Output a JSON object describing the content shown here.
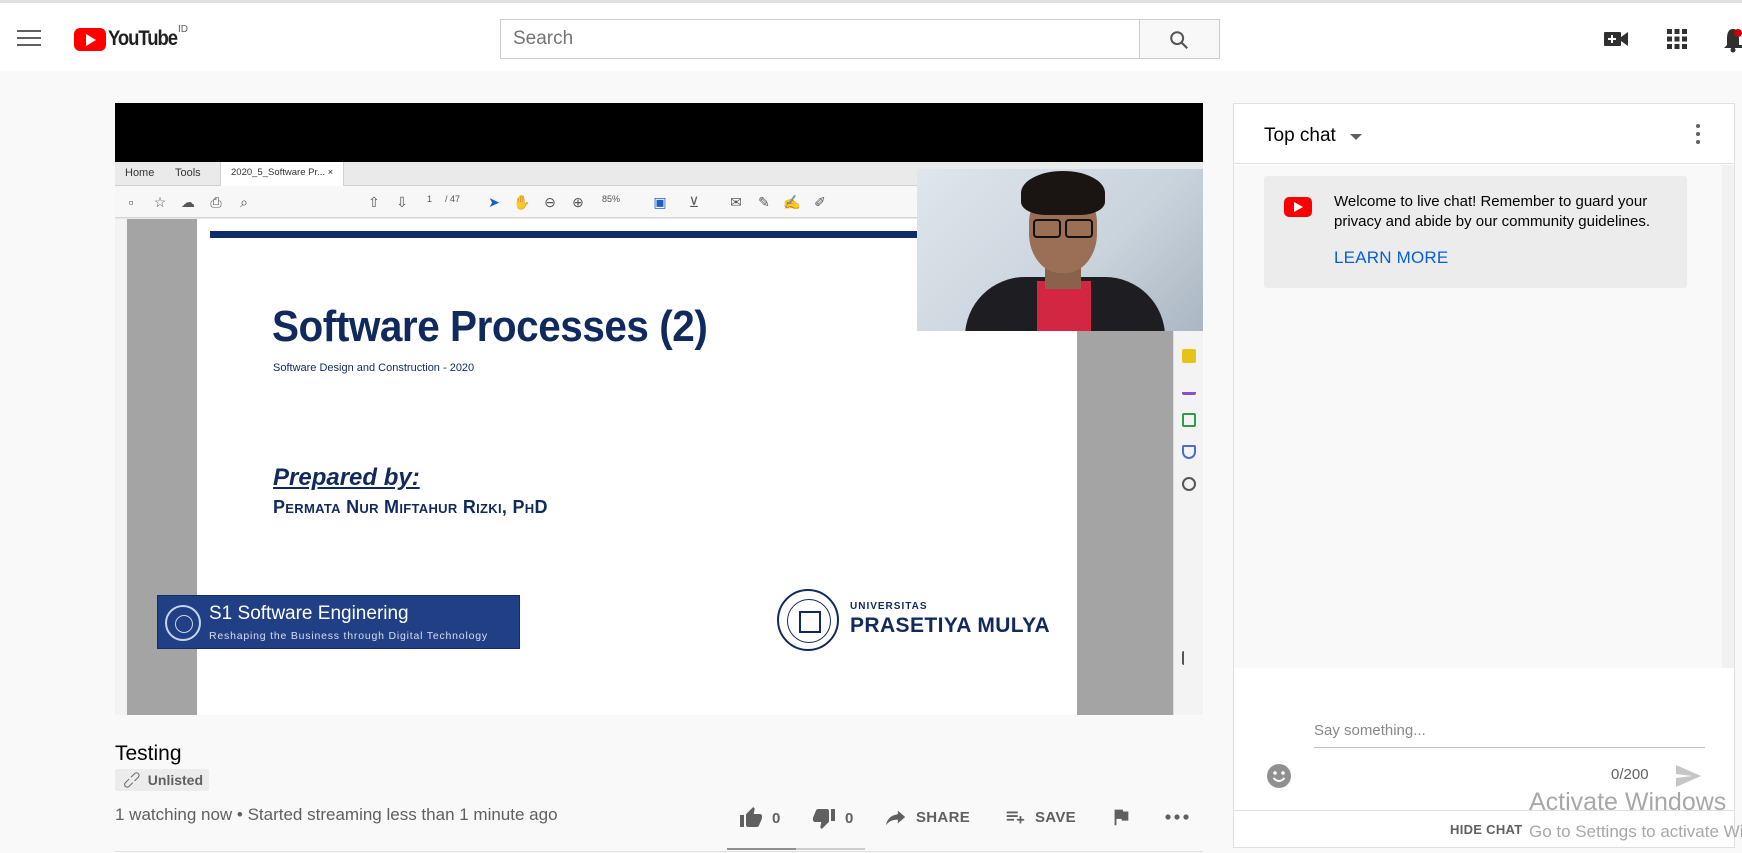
{
  "header": {
    "logo_text": "YouTube",
    "country_code": "ID",
    "search_placeholder": "Search"
  },
  "player": {
    "pdf_viewer": {
      "tabs": [
        "Home",
        "Tools",
        "2020_5_Software Pr..."
      ],
      "page_current": "1",
      "page_total": "/ 47",
      "zoom": "85%"
    },
    "slide": {
      "title": "Software Processes (2)",
      "subtitle": "Software Design and Construction  -  2020",
      "prepared_label": "Prepared by:",
      "author": "Permata Nur Miftahur Rizki, PhD",
      "badge_title": "S1 Software Enginering",
      "badge_tagline": "Reshaping the Business through Digital Technology",
      "university_line1": "UNIVERSITAS",
      "university_line2": "PRASETIYA MULYA"
    }
  },
  "video": {
    "title": "Testing",
    "visibility": "Unlisted",
    "meta": "1 watching now • Started streaming less than 1 minute ago",
    "likes": "0",
    "dislikes": "0",
    "share_label": "SHARE",
    "save_label": "SAVE",
    "like_ratio": 0.5
  },
  "chat": {
    "title": "Top chat",
    "welcome_text": "Welcome to live chat! Remember to guard your privacy and abide by our community guidelines.",
    "learn_more": "LEARN MORE",
    "input_placeholder": "Say something...",
    "char_count": "0/200",
    "hide_chat": "HIDE CHAT"
  },
  "os_overlay": {
    "line1": "Activate Windows",
    "line2": "Go to Settings to activate Windows."
  },
  "colors": {
    "brand_red": "#ff0000",
    "link_blue": "#065fd4",
    "slide_navy": "#102a5e"
  }
}
